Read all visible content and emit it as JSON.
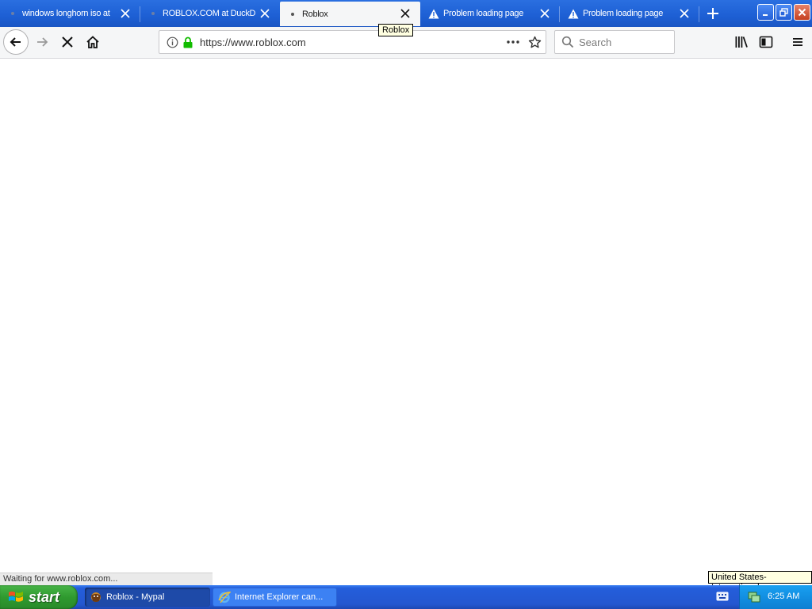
{
  "tabs": [
    {
      "title": "windows longhorn iso at",
      "icon": "dot-favicon",
      "active": false
    },
    {
      "title": "ROBLOX.COM at DuckD",
      "icon": "dot-favicon",
      "active": false
    },
    {
      "title": "Roblox",
      "icon": "dot-favicon",
      "active": true
    },
    {
      "title": "Problem loading page",
      "icon": "warning-icon",
      "active": false
    },
    {
      "title": "Problem loading page",
      "icon": "warning-icon",
      "active": false
    }
  ],
  "tab_tooltip": "Roblox",
  "urlbar": {
    "url": "https://www.roblox.com"
  },
  "search": {
    "placeholder": "Search"
  },
  "status_text": "Waiting for www.roblox.com...",
  "language_tooltip": "United States-International",
  "taskbar": {
    "start_label": "start",
    "tasks": [
      {
        "label": "Roblox - Mypal",
        "icon": "mypal-icon",
        "active": true
      },
      {
        "label": "Internet Explorer can...",
        "icon": "ie-icon",
        "active": false
      }
    ],
    "clock": "6:25 AM"
  },
  "colors": {
    "titlebar": "#1d5fd4",
    "taskbar": "#245edb",
    "start": "#2f9a2f",
    "tray": "#128fe2"
  }
}
